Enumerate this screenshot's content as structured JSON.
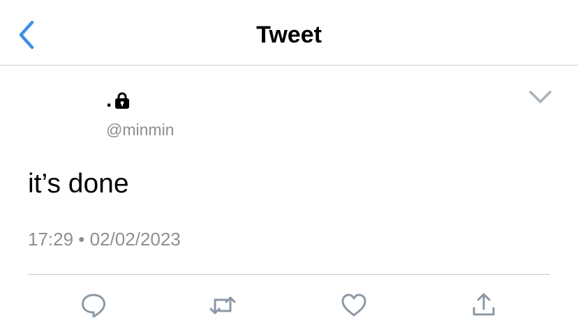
{
  "header": {
    "title": "Tweet",
    "back_icon": "chevron-left-icon",
    "accent_color": "#3d8ee6"
  },
  "tweet": {
    "author_name_prefix": ".",
    "author_name_icon": "lock-icon",
    "author_handle": "@minmin",
    "text": "it’s done",
    "meta": "17:29 • 02/02/2023",
    "menu_icon": "chevron-down-icon"
  },
  "actions": [
    {
      "name": "reply",
      "icon": "reply-icon"
    },
    {
      "name": "retweet",
      "icon": "retweet-icon"
    },
    {
      "name": "like",
      "icon": "heart-icon"
    },
    {
      "name": "share",
      "icon": "share-icon"
    }
  ],
  "colors": {
    "text_primary": "#000000",
    "text_secondary": "#8b8f93",
    "icon_gray": "#8b98a5",
    "divider": "#c8c8cc"
  }
}
